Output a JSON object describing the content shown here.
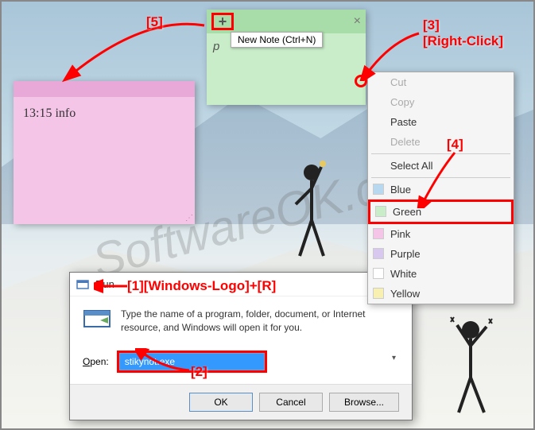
{
  "watermark": "SoftwareOK.com",
  "pink_note": {
    "text": "13:15 info"
  },
  "green_note": {
    "plus": "+",
    "close": "×",
    "body_char": "p",
    "tooltip": "New Note (Ctrl+N)"
  },
  "context_menu": {
    "items": [
      {
        "label": "Cut",
        "disabled": true
      },
      {
        "label": "Copy",
        "disabled": true
      },
      {
        "label": "Paste",
        "disabled": false
      },
      {
        "label": "Delete",
        "disabled": true
      }
    ],
    "select_all": "Select All",
    "colors": [
      {
        "label": "Blue",
        "hex": "#b8d8f0"
      },
      {
        "label": "Green",
        "hex": "#c8edc8",
        "selected": true
      },
      {
        "label": "Pink",
        "hex": "#f5c5e8"
      },
      {
        "label": "Purple",
        "hex": "#d8c8f0"
      },
      {
        "label": "White",
        "hex": "#ffffff"
      },
      {
        "label": "Yellow",
        "hex": "#f8f0b0"
      }
    ]
  },
  "run_dialog": {
    "title": "Run",
    "description": "Type the name of a program, folder, document, or Internet resource, and Windows will open it for you.",
    "open_label": "Open:",
    "input_value": "stikynot.exe",
    "ok": "OK",
    "cancel": "Cancel",
    "browse": "Browse..."
  },
  "annotations": {
    "a1": "[1][Windows-Logo]+[R]",
    "a2": "[2]",
    "a3_line1": "[3]",
    "a3_line2": "[Right-Click]",
    "a4": "[4]",
    "a5": "[5]"
  }
}
